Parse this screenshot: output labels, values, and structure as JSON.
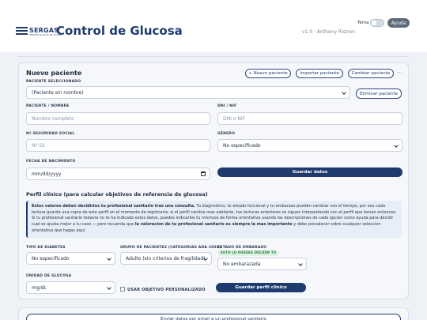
{
  "header": {
    "logo_text": "SERGAS",
    "logo_subtext": "SERVIZO GALEGO DE SAÚDE",
    "title": "Control de Glucosa",
    "version": "v1.0 · Anthony Ristron",
    "theme_label": "Tema",
    "theme_toggle_on": false,
    "help_label": "Ayuda"
  },
  "patient": {
    "section_title": "Nuevo paciente",
    "btn_new": "+ Nuevo paciente",
    "btn_import": "Importar paciente",
    "btn_change": "Cambiar paciente",
    "more": "···",
    "selected_label": "PACIENTE SELECCIONADO",
    "selected_value": "(Paciente sin nombre)",
    "btn_delete": "Eliminar paciente",
    "name_label": "PACIENTE / NOMBRE",
    "name_placeholder": "Nombre completo",
    "dni_label": "DNI / NIF",
    "dni_placeholder": "DNI o NIF",
    "nss_label": "Nº SEGURIDAD SOCIAL",
    "nss_placeholder": "Nº SS",
    "gender_label": "GÉNERO",
    "gender_value": "No especificado",
    "dob_label": "FECHA DE NACIMIENTO",
    "dob_value": "mm/dd/yyyy",
    "btn_save": "Guardar datos"
  },
  "clinical": {
    "section_title": "Perfil clínico (para calcular objetivos de referencia de glucosa)",
    "info_bold_1": "Estos valores deben decidirlos tu profesional sanitario tras una consulta.",
    "info_text_1": " Tu diagnostico, tu estado funcional y tu embarazo pueden cambiar con el tiempo, por eso cada lectura guarda una copia de este perfil en el momento de registrarla: si el perfil cambia mas adelante, tus lecturas anteriores se siguen interpretando con el perfil que tenian entonces. Si tu profesional sanitario todavia no te ha indicado estos datos, puedes indicarlos tu mismo/a de forma orientativa usando las descripciones de cada opcion como ayuda para decidir cual se ajusta mejor a tu caso — pero recuerda que ",
    "info_bold_2": "la valoracion de tu profesional sanitario es siempre la mas importante",
    "info_text_2": " y debe prevalecer sobre cualquier seleccion orientativa que hagas aqui.",
    "diabetes_label": "TIPO DE DIABETES",
    "diabetes_value": "No especificado",
    "group_label": "GRUPO DE PACIENTES (CATEGORIAS ADA 2026)",
    "group_value": "Adulto (sin criterios de fragilidad)",
    "pregnancy_label": "ESTADO DE EMBARAZO",
    "pregnancy_badge": "ESTO LO PUEDES DECIDIR TU",
    "pregnancy_value": "No embarazada",
    "unit_label": "UNIDAD DE GLUCOSA",
    "unit_value": "mg/dL",
    "custom_objective_label": "USAR OBJETIVO PERSONALIZADO",
    "btn_save_profile": "Guardar perfil clinico"
  },
  "email": {
    "btn_send": "Enviar datos por email a un profesional sanitario"
  }
}
